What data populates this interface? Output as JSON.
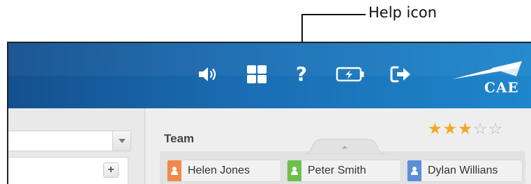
{
  "callout": {
    "label": "Help icon"
  },
  "topbar": {
    "icons": [
      "speaker-icon",
      "grid-icon",
      "help-icon",
      "battery-icon",
      "logout-icon"
    ],
    "help_glyph": "?",
    "logo_text": "CAE"
  },
  "colors": {
    "topbar_left": "#14508f",
    "topbar_right": "#1e86cc",
    "star_on": "#f5a623",
    "star_off": "#b9b9b9",
    "badge_orange": "#f08a4b",
    "badge_green": "#6cc04a",
    "badge_blue": "#5b8ed6"
  },
  "rating": {
    "value": 3,
    "max": 5
  },
  "team": {
    "label": "Team",
    "members": [
      {
        "name": "Helen Jones",
        "color": "orange"
      },
      {
        "name": "Peter Smith",
        "color": "green"
      },
      {
        "name": "Dylan Willians",
        "color": "blue"
      }
    ]
  },
  "left_panel": {
    "add_label": "+"
  }
}
